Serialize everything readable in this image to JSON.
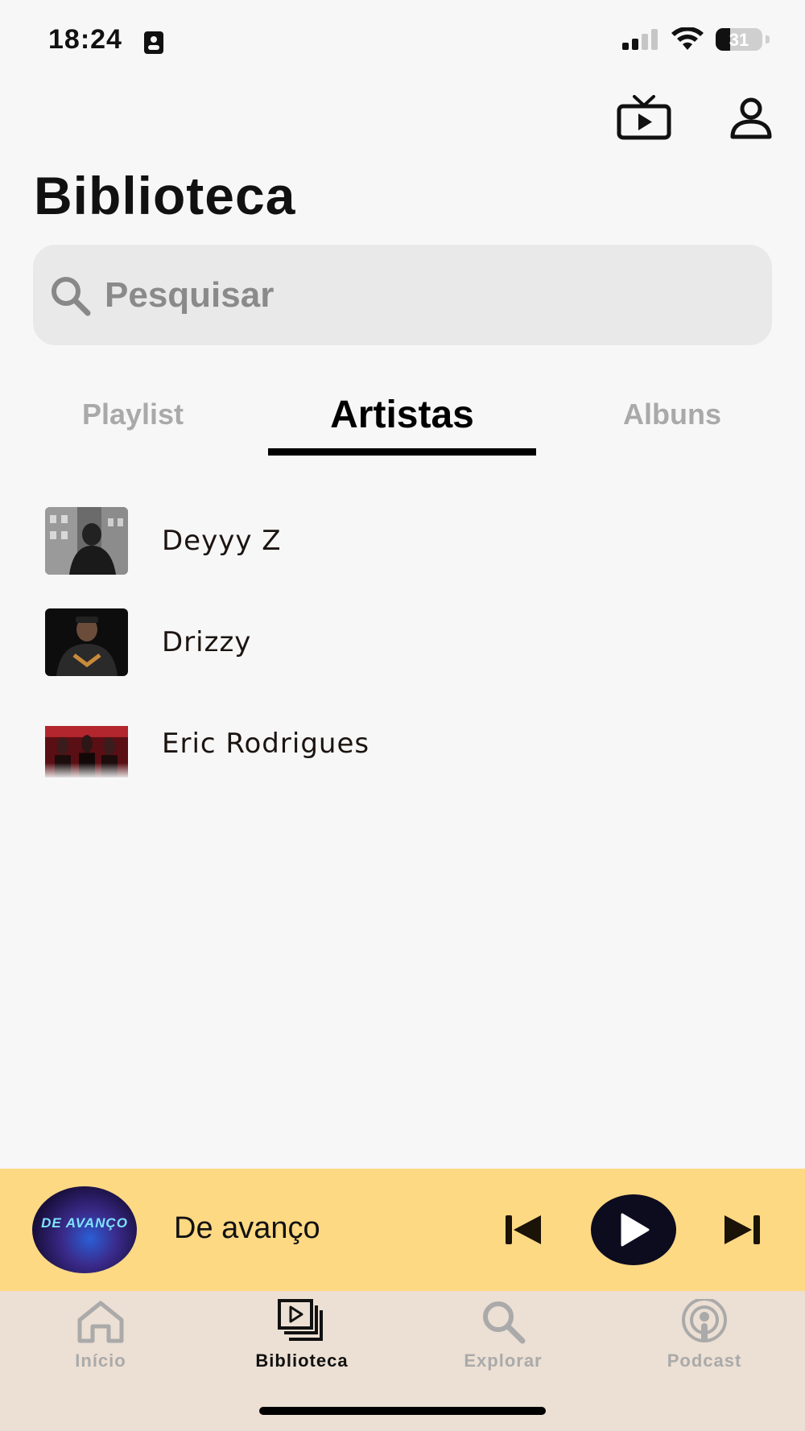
{
  "status_bar": {
    "time": "18:24",
    "battery": "31"
  },
  "page": {
    "title": "Biblioteca"
  },
  "search": {
    "placeholder": "Pesquisar"
  },
  "tabs": [
    {
      "label": "Playlist",
      "active": false
    },
    {
      "label": "Artistas",
      "active": true
    },
    {
      "label": "Albuns",
      "active": false
    }
  ],
  "artists": [
    {
      "name": "Deyyy Z"
    },
    {
      "name": "Drizzy"
    },
    {
      "name": "Eric Rodrigues"
    }
  ],
  "player": {
    "track_title": "De avanço",
    "cover_text": "DE AVANÇO"
  },
  "bottom_nav": [
    {
      "label": "Início",
      "icon": "home-icon",
      "active": false
    },
    {
      "label": "Biblioteca",
      "icon": "library-icon",
      "active": true
    },
    {
      "label": "Explorar",
      "icon": "search-icon",
      "active": false
    },
    {
      "label": "Podcast",
      "icon": "podcast-icon",
      "active": false
    }
  ],
  "colors": {
    "background": "#f7f7f7",
    "player_background": "#fed984",
    "tabbar_background": "#ecdfd3",
    "search_background": "#e9e9e9",
    "active_text": "#000000",
    "inactive_text": "#a9a9a9"
  }
}
